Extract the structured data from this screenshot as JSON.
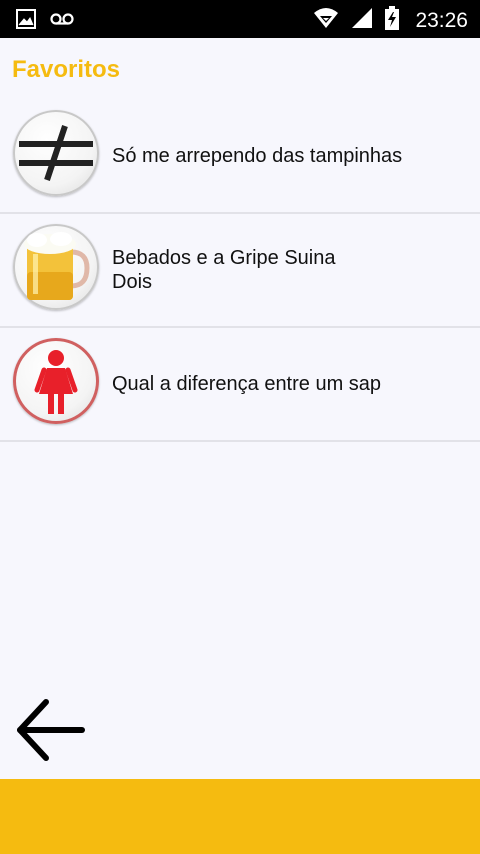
{
  "status_bar": {
    "time": "23:26",
    "icons": [
      "image-icon",
      "voicemail-icon",
      "wifi-icon",
      "signal-icon",
      "battery-charging-icon"
    ]
  },
  "page": {
    "title": "Favoritos"
  },
  "favorites": [
    {
      "label": "Só me arrependo das tampinhas",
      "icon": "not-equal-icon"
    },
    {
      "label": "Bebados e a Gripe Suina\nDois",
      "icon": "beer-mug-icon"
    },
    {
      "label": "Qual a diferença entre um sap",
      "icon": "woman-icon"
    }
  ],
  "navigation": {
    "back_icon": "arrow-left-icon"
  },
  "colors": {
    "accent": "#f5bb10",
    "background": "#f7f7fd",
    "status_bar": "#000000"
  }
}
